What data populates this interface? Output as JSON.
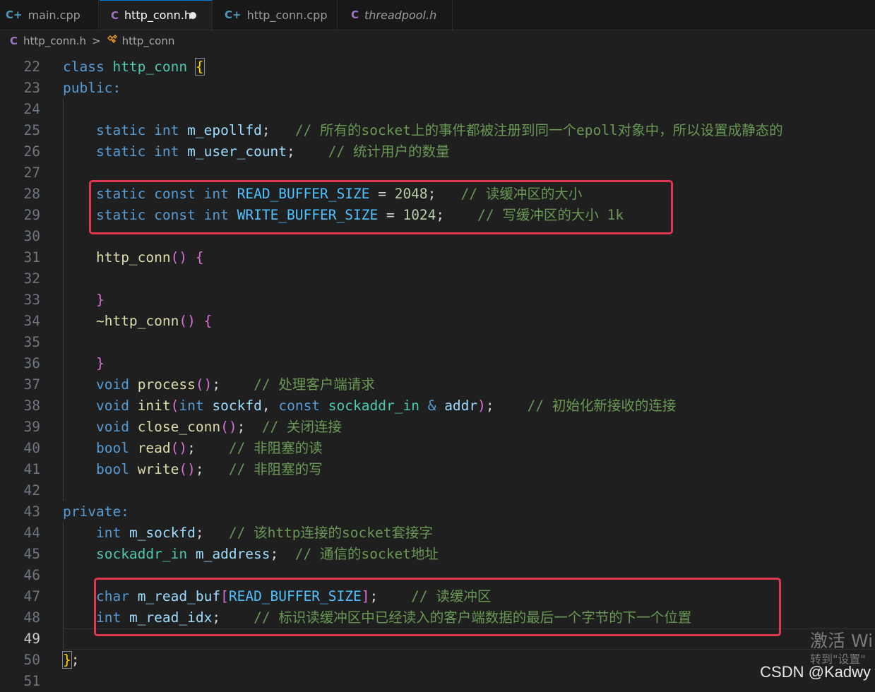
{
  "tabs": [
    {
      "icon": "C+",
      "label": "main.cpp"
    },
    {
      "icon": "C",
      "label": "http_conn.h"
    },
    {
      "icon": "C+",
      "label": "http_conn.cpp"
    },
    {
      "icon": "C",
      "label": "threadpool.h"
    }
  ],
  "breadcrumb": {
    "file_icon": "C",
    "file": "http_conn.h",
    "separator": ">",
    "symbol": "http_conn"
  },
  "line_numbers": [
    "22",
    "23",
    "24",
    "25",
    "26",
    "27",
    "28",
    "29",
    "30",
    "31",
    "32",
    "33",
    "34",
    "35",
    "36",
    "37",
    "38",
    "39",
    "40",
    "41",
    "42",
    "43",
    "44",
    "45",
    "46",
    "47",
    "48",
    "49",
    "50",
    "51"
  ],
  "code": {
    "l22": {
      "kw": "class",
      "name": "http_conn",
      "brace": "{"
    },
    "l23": {
      "text": "public:"
    },
    "l25": {
      "kw1": "static",
      "kw2": "int",
      "var": "m_epollfd",
      "semi": ";",
      "comment": "// 所有的socket上的事件都被注册到同一个epoll对象中，所以设置成静态的"
    },
    "l26": {
      "kw1": "static",
      "kw2": "int",
      "var": "m_user_count",
      "semi": ";",
      "comment": "// 统计用户的数量"
    },
    "l28": {
      "kw1": "static",
      "kw2": "const",
      "kw3": "int",
      "const": "READ_BUFFER_SIZE",
      "eq": "=",
      "num": "2048",
      "semi": ";",
      "comment": "// 读缓冲区的大小"
    },
    "l29": {
      "kw1": "static",
      "kw2": "const",
      "kw3": "int",
      "const": "WRITE_BUFFER_SIZE",
      "eq": "=",
      "num": "1024",
      "semi": ";",
      "comment": "// 写缓冲区的大小 1k"
    },
    "l31": {
      "fn": "http_conn",
      "paren": "()",
      "brace": "{"
    },
    "l33": {
      "brace": "}"
    },
    "l34": {
      "fn": "~http_conn",
      "paren": "()",
      "brace": "{"
    },
    "l36": {
      "brace": "}"
    },
    "l37": {
      "kw": "void",
      "fn": "process",
      "paren": "()",
      "semi": ";",
      "comment": "// 处理客户端请求"
    },
    "l38": {
      "kw": "void",
      "fn": "init",
      "open": "(",
      "p1type": "int",
      "p1": "sockfd",
      "comma": ",",
      "p2kw": "const",
      "p2type": "sockaddr_in",
      "amp": "&",
      "p2": "addr",
      "close": ")",
      "semi": ";",
      "comment": "// 初始化新接收的连接"
    },
    "l39": {
      "kw": "void",
      "fn": "close_conn",
      "paren": "()",
      "semi": ";",
      "comment": "// 关闭连接"
    },
    "l40": {
      "kw": "bool",
      "fn": "read",
      "paren": "()",
      "semi": ";",
      "comment": "// 非阻塞的读"
    },
    "l41": {
      "kw": "bool",
      "fn": "write",
      "paren": "()",
      "semi": ";",
      "comment": "// 非阻塞的写"
    },
    "l43": {
      "text": "private:"
    },
    "l44": {
      "kw": "int",
      "var": "m_sockfd",
      "semi": ";",
      "comment": "// 该http连接的socket套接字"
    },
    "l45": {
      "type": "sockaddr_in",
      "var": "m_address",
      "semi": ";",
      "comment": "// 通信的socket地址"
    },
    "l47": {
      "kw": "char",
      "var": "m_read_buf",
      "open": "[",
      "const": "READ_BUFFER_SIZE",
      "close": "]",
      "semi": ";",
      "comment": "// 读缓冲区"
    },
    "l48": {
      "kw": "int",
      "var": "m_read_idx",
      "semi": ";",
      "comment": "// 标识读缓冲区中已经读入的客户端数据的最后一个字节的下一个位置"
    },
    "l50": {
      "brace": "}",
      "semi": ";"
    }
  },
  "watermark": {
    "line1": "激活 Wi",
    "line2": "转到\"设置\""
  },
  "csdn": "CSDN @Kadwy",
  "colors": {
    "highlight_box": "#e0384f",
    "keyword": "#569cd6",
    "type": "#4ec9b0",
    "function": "#dcdcaa",
    "comment": "#6a9955",
    "constant": "#4fc1ff",
    "number": "#b5cea8"
  }
}
